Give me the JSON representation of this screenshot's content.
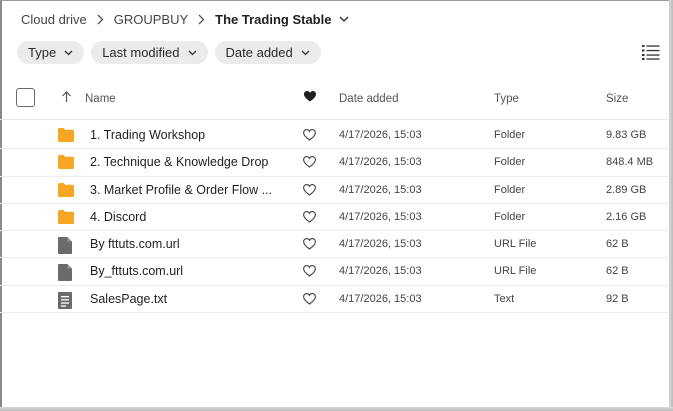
{
  "breadcrumb": {
    "root": "Cloud drive",
    "parent": "GROUPBUY",
    "current": "The Trading Stable"
  },
  "filters": [
    {
      "label": "Type"
    },
    {
      "label": "Last modified"
    },
    {
      "label": "Date added"
    }
  ],
  "header": {
    "name": "Name",
    "date_added": "Date added",
    "type": "Type",
    "size": "Size"
  },
  "colors": {
    "folder": "#f5a623",
    "file": "#6b6b6b",
    "chip_bg": "#ebebeb"
  },
  "rows": [
    {
      "name": "1. Trading Workshop",
      "date": "4/17/2026, 15:03",
      "type": "Folder",
      "size": "9.83 GB",
      "icon": "folder-icon"
    },
    {
      "name": "2. Technique & Knowledge Drop",
      "date": "4/17/2026, 15:03",
      "type": "Folder",
      "size": "848.4 MB",
      "icon": "folder-icon"
    },
    {
      "name": "3. Market Profile & Order Flow ...",
      "date": "4/17/2026, 15:03",
      "type": "Folder",
      "size": "2.89 GB",
      "icon": "folder-icon"
    },
    {
      "name": "4. Discord",
      "date": "4/17/2026, 15:03",
      "type": "Folder",
      "size": "2.16 GB",
      "icon": "folder-icon"
    },
    {
      "name": "By fttuts.com.url",
      "date": "4/17/2026, 15:03",
      "type": "URL File",
      "size": "62 B",
      "icon": "file-icon"
    },
    {
      "name": "By_fttuts.com.url",
      "date": "4/17/2026, 15:03",
      "type": "URL File",
      "size": "62 B",
      "icon": "file-icon"
    },
    {
      "name": "SalesPage.txt",
      "date": "4/17/2026, 15:03",
      "type": "Text",
      "size": "92 B",
      "icon": "text-file-icon"
    }
  ]
}
